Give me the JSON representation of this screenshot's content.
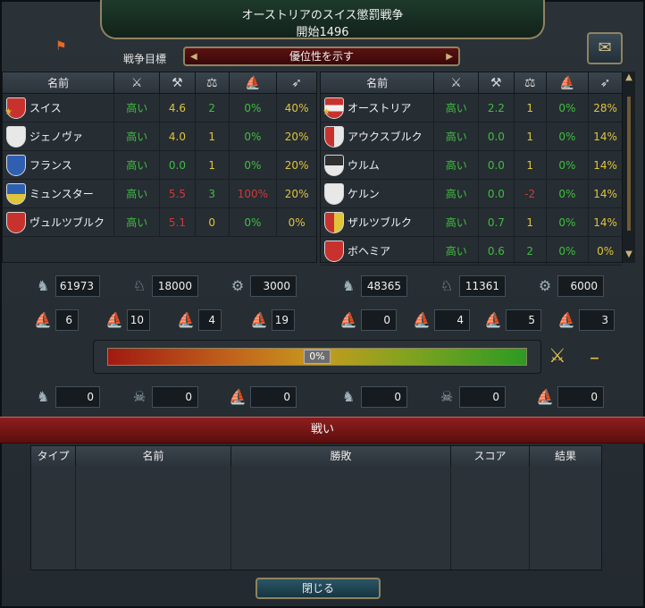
{
  "window": {
    "title": "オーストリアのスイス懲罰戦争",
    "start": "開始1496"
  },
  "war_goal": {
    "label": "戦争目標",
    "value": "優位性を示す"
  },
  "table_headers": {
    "name": "名前"
  },
  "attackers": [
    {
      "name": "スイス",
      "v1": "高い",
      "v2": "4.6",
      "v3": "2",
      "v4": "0%",
      "v5": "40%",
      "shield": "#c8322e",
      "star": true
    },
    {
      "name": "ジェノヴァ",
      "v1": "高い",
      "v2": "4.0",
      "v3": "1",
      "v4": "0%",
      "v5": "20%",
      "shield": "#e8e8e8",
      "star": false
    },
    {
      "name": "フランス",
      "v1": "高い",
      "v2": "0.0",
      "v3": "1",
      "v4": "0%",
      "v5": "20%",
      "shield": "#2f5fb0",
      "star": false
    },
    {
      "name": "ミュンスター",
      "v1": "高い",
      "v2": "5.5",
      "v3": "3",
      "v4": "100%",
      "v5": "20%",
      "shield": "#2f5fb0",
      "star": false
    },
    {
      "name": "ヴュルツブルク",
      "v1": "高い",
      "v2": "5.1",
      "v3": "0",
      "v4": "0%",
      "v5": "0%",
      "shield": "#c8322e",
      "star": false
    }
  ],
  "defenders": [
    {
      "name": "オーストリア",
      "v1": "高い",
      "v2": "2.2",
      "v3": "1",
      "v4": "0%",
      "v5": "28%",
      "shield": "#c8322e",
      "star": true
    },
    {
      "name": "アウクスブルク",
      "v1": "高い",
      "v2": "0.0",
      "v3": "1",
      "v4": "0%",
      "v5": "14%",
      "shield": "#c8322e",
      "star": false
    },
    {
      "name": "ウルム",
      "v1": "高い",
      "v2": "0.0",
      "v3": "1",
      "v4": "0%",
      "v5": "14%",
      "shield": "#303030",
      "star": false
    },
    {
      "name": "ケルン",
      "v1": "高い",
      "v2": "0.0",
      "v3": "-2",
      "v4": "0%",
      "v5": "14%",
      "shield": "#e8e8e8",
      "star": false
    },
    {
      "name": "ザルツブルク",
      "v1": "高い",
      "v2": "0.7",
      "v3": "1",
      "v4": "0%",
      "v5": "14%",
      "shield": "#c8322e",
      "star": false
    },
    {
      "name": "ボヘミア",
      "v1": "高い",
      "v2": "0.6",
      "v3": "2",
      "v4": "0%",
      "v5": "0%",
      "shield": "#c8322e",
      "star": false
    }
  ],
  "attacker_forces": {
    "infantry": "61973",
    "cavalry": "18000",
    "artillery": "3000",
    "heavy_ships": "6",
    "light_ships": "10",
    "galleys": "4",
    "transports": "19",
    "losses_infantry": "0",
    "losses_cavalry": "0",
    "losses_ships": "0"
  },
  "defender_forces": {
    "infantry": "48365",
    "cavalry": "11361",
    "artillery": "6000",
    "heavy_ships": "0",
    "light_ships": "4",
    "galleys": "5",
    "transports": "3",
    "losses_infantry": "0",
    "losses_cavalry": "0",
    "losses_ships": "0"
  },
  "war_score": {
    "value": 0,
    "label": "0%"
  },
  "battles": {
    "title": "戦い",
    "columns": [
      "タイプ",
      "名前",
      "勝敗",
      "スコア",
      "結果"
    ]
  },
  "close_button": "閉じる"
}
